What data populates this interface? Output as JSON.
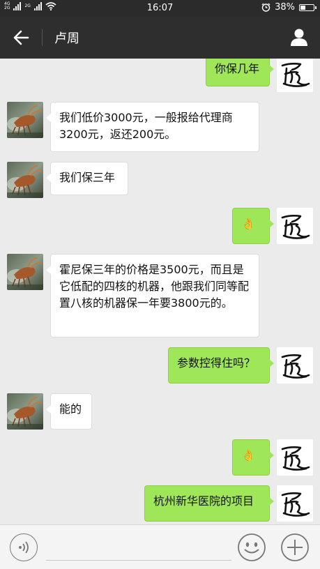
{
  "status_bar": {
    "network_top": "4G",
    "network_bottom": "2G",
    "network2": "2G",
    "time": "16:07",
    "battery": "38%",
    "battery_level": 0.38
  },
  "header": {
    "title": "卢周"
  },
  "messages": [
    {
      "side": "mine",
      "text": "你保几年"
    },
    {
      "side": "theirs",
      "text": "我们低价3000元，一般报给代理商3200元，返还200元。"
    },
    {
      "side": "theirs",
      "text": "我们保三年"
    },
    {
      "side": "mine",
      "text": "👌"
    },
    {
      "side": "theirs",
      "text": "霍尼保三年的价格是3500元，而且是它低配的四核的机器，他跟我们同等配置八核的机器保一年要3800元的。"
    },
    {
      "side": "mine",
      "text": "参数控得住吗？"
    },
    {
      "side": "theirs",
      "text": "能的"
    },
    {
      "side": "mine",
      "text": "👌"
    },
    {
      "side": "mine",
      "text": "杭州新华医院的项目"
    }
  ],
  "colors": {
    "mine_bubble": "#9fe658",
    "header_bg": "#2e2e2e",
    "chat_bg": "#ebebeb"
  }
}
